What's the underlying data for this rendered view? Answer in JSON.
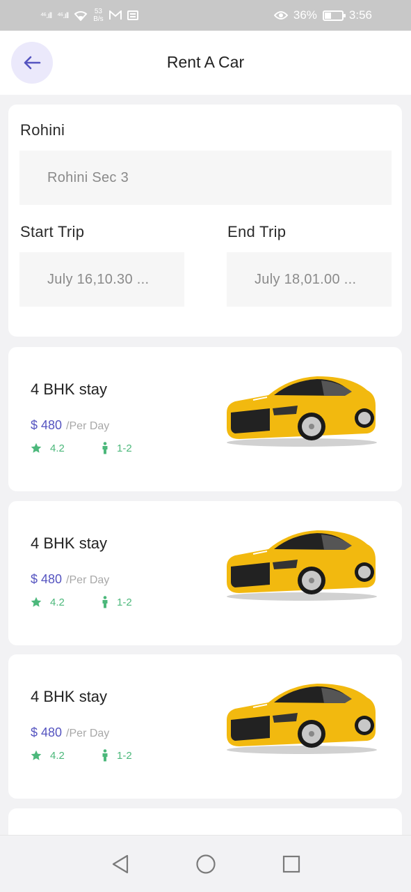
{
  "status_bar": {
    "signal1": "⁴⁶.ıll",
    "signal2": "⁴⁶.ıll",
    "speed_value": "53",
    "speed_unit": "B/s",
    "battery": "36%",
    "time": "3:56",
    "battery_level": 0.36
  },
  "header": {
    "title": "Rent A Car"
  },
  "booking": {
    "location_label": "Rohini",
    "location_value": "Rohini Sec 3",
    "start_label": "Start Trip",
    "start_value": "July 16,10.30 ...",
    "end_label": "End Trip",
    "end_value": "July 18,01.00 ..."
  },
  "cars": [
    {
      "name": "4 BHK stay",
      "price": "$ 480",
      "per": "/Per Day",
      "rating": "4.2",
      "seats": "1-2"
    },
    {
      "name": "4 BHK stay",
      "price": "$ 480",
      "per": "/Per Day",
      "rating": "4.2",
      "seats": "1-2"
    },
    {
      "name": "4 BHK stay",
      "price": "$ 480",
      "per": "/Per Day",
      "rating": "4.2",
      "seats": "1-2"
    }
  ],
  "colors": {
    "accent": "#5554c0",
    "accent_soft": "#ebe9fb",
    "green": "#4cb87b",
    "car_yellow": "#f2b90f"
  },
  "icons": {
    "back": "arrow-left-icon",
    "rating": "star-icon",
    "seats": "person-icon",
    "nav_back": "triangle-back-icon",
    "nav_home": "circle-home-icon",
    "nav_recent": "square-recents-icon"
  }
}
